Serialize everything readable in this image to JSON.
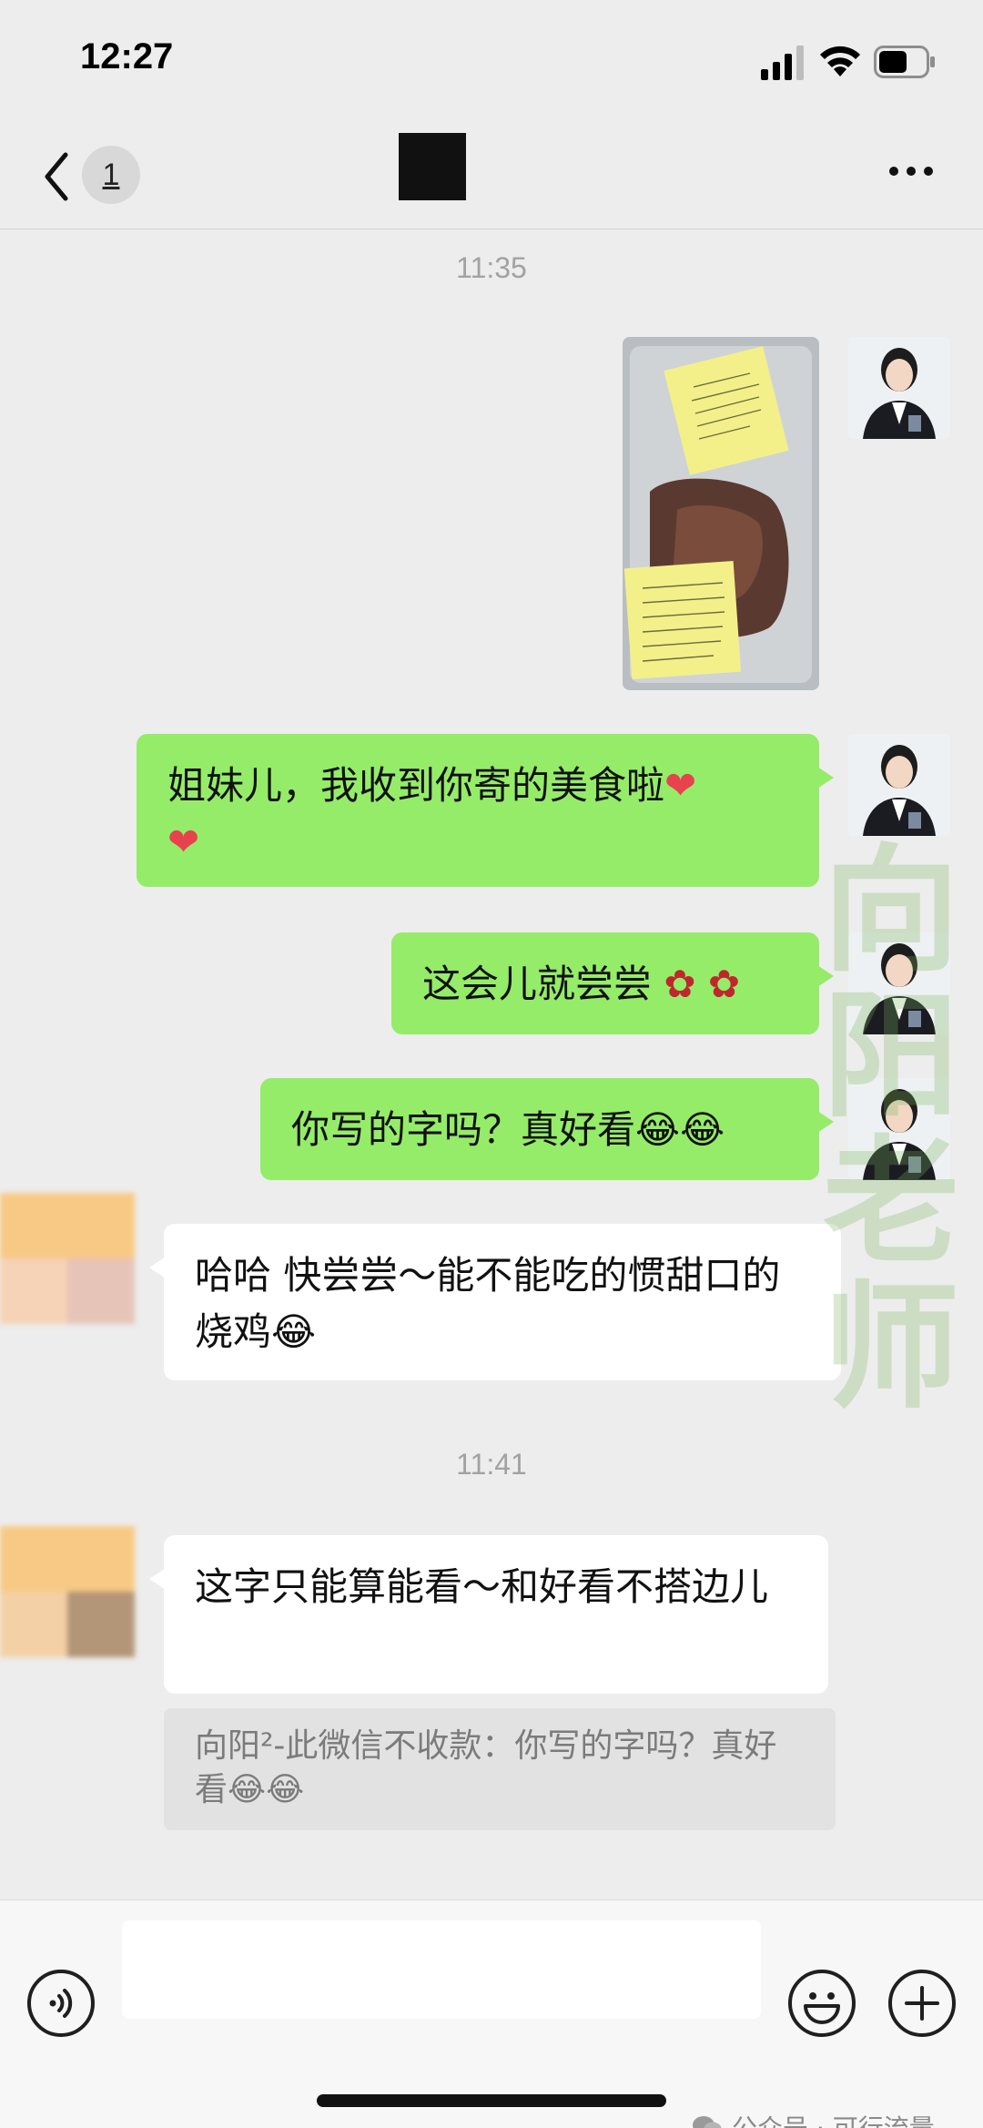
{
  "status_bar": {
    "time": "12:27"
  },
  "nav": {
    "unread_count": "1"
  },
  "messages": {
    "time_1": "11:35",
    "out_1": "姐妹儿，我收到你寄的美食啦",
    "out_2": "这会儿就尝尝",
    "out_3": "你写的字吗？真好看",
    "in_1": "哈哈 快尝尝～能不能吃的惯甜口的烧鸡",
    "time_2": "11:41",
    "in_2": "这字只能算能看～和好看不搭边儿",
    "quote": "向阳²-此微信不收款：你写的字吗？真好看"
  },
  "watermark": {
    "text": "向阳老师"
  },
  "footer": {
    "source": "公众号 · 可行流量"
  }
}
